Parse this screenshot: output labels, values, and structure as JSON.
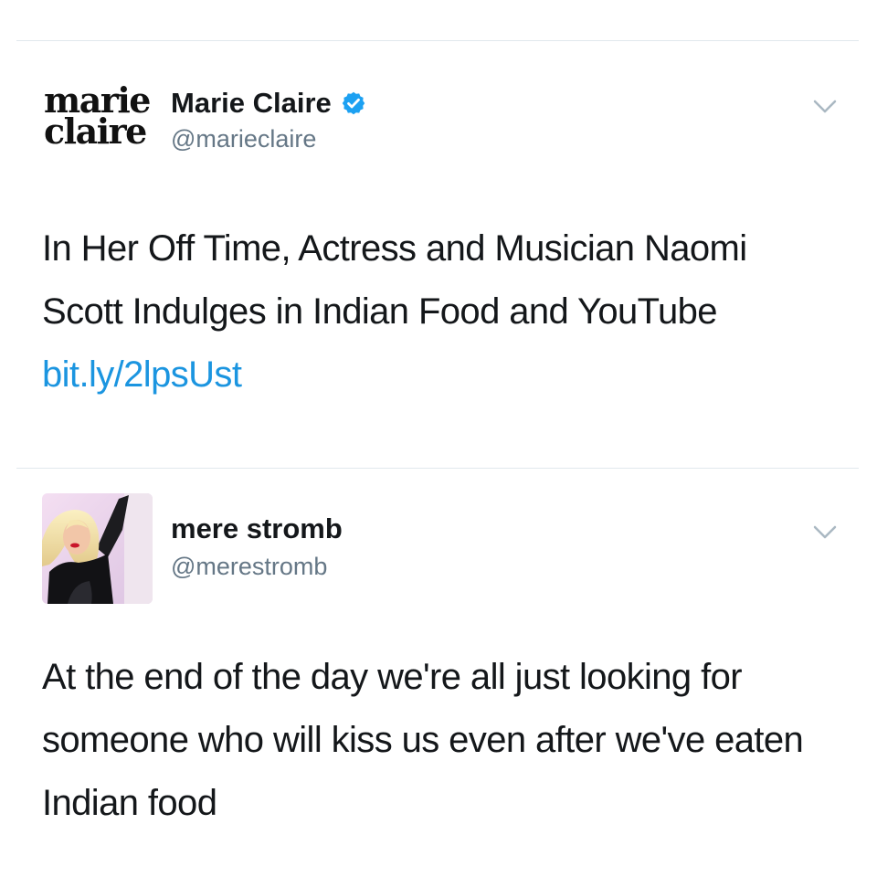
{
  "tweets": [
    {
      "display_name": "Marie Claire",
      "handle": "@marieclaire",
      "verified": true,
      "avatar": {
        "type": "logo",
        "line1": "marie",
        "line2": "claire"
      },
      "text": "In Her Off Time, Actress and Musician Naomi Scott Indulges in Indian Food and YouTube",
      "link": "bit.ly/2lpsUst"
    },
    {
      "display_name": "mere stromb",
      "handle": "@merestromb",
      "verified": false,
      "avatar": {
        "type": "photo"
      },
      "text": "At the end of the day we're all just looking for someone who will kiss us even after we've eaten Indian food"
    }
  ],
  "icons": {
    "menu": "chevron-down-icon",
    "verified": "verified-badge-icon"
  },
  "colors": {
    "link": "#1b95e0",
    "handle": "#657786",
    "text": "#14171a",
    "divider": "#e1e8ed",
    "verified": "#1da1f2"
  }
}
